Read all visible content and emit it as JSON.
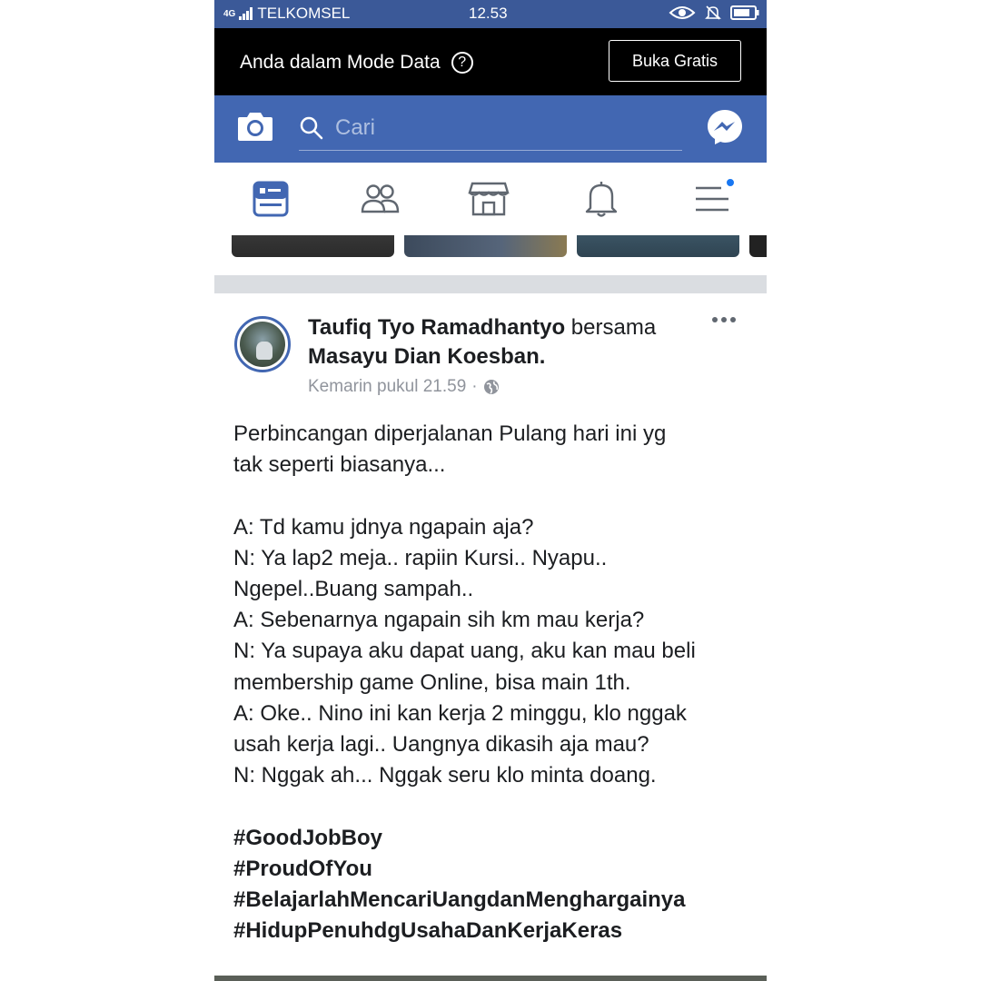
{
  "status_bar": {
    "signal": "4G",
    "carrier": "TELKOMSEL",
    "time": "12.53"
  },
  "data_banner": {
    "message": "Anda dalam Mode Data",
    "help_icon": "question-circle-icon",
    "button_label": "Buka Gratis"
  },
  "header": {
    "search_placeholder": "Cari",
    "camera_icon": "camera-icon",
    "messenger_icon": "messenger-icon"
  },
  "tabs": [
    {
      "name": "news-feed",
      "icon": "news-feed-icon",
      "active": true
    },
    {
      "name": "friends",
      "icon": "friends-icon"
    },
    {
      "name": "marketplace",
      "icon": "marketplace-icon"
    },
    {
      "name": "notifications",
      "icon": "bell-icon"
    },
    {
      "name": "menu",
      "icon": "menu-icon",
      "badge": true
    }
  ],
  "post": {
    "author": "Taufiq Tyo Ramadhantyo",
    "with_word": "bersama",
    "tagged": "Masayu Dian Koesban.",
    "timestamp": "Kemarin pukul 21.59",
    "privacy_icon": "globe-icon",
    "lines": [
      "Perbincangan diperjalanan Pulang hari ini yg",
      "tak seperti biasanya...",
      "",
      "A: Td kamu jdnya ngapain aja?",
      "N: Ya lap2 meja.. rapiin Kursi.. Nyapu..",
      "Ngepel..Buang sampah..",
      "A: Sebenarnya ngapain sih km mau kerja?",
      "N: Ya supaya aku dapat uang, aku kan mau beli",
      "membership game Online, bisa main 1th.",
      "A: Oke.. Nino ini kan kerja 2 minggu, klo nggak",
      "usah kerja lagi.. Uangnya dikasih aja mau?",
      "N: Nggak ah... Nggak seru klo minta doang.",
      ""
    ],
    "hashtags": [
      "#GoodJobBoy",
      "#ProudOfYou",
      "#BelajarlahMencariUangdanMenghargainya",
      "#HidupPenuhdgUsahaDanKerjaKeras"
    ]
  },
  "colors": {
    "fb_blue": "#4267b2",
    "status_blue": "#3b5998",
    "banner_black": "#000000",
    "text": "#1c1e21",
    "meta_gray": "#90949c",
    "divider": "#dadde1"
  }
}
